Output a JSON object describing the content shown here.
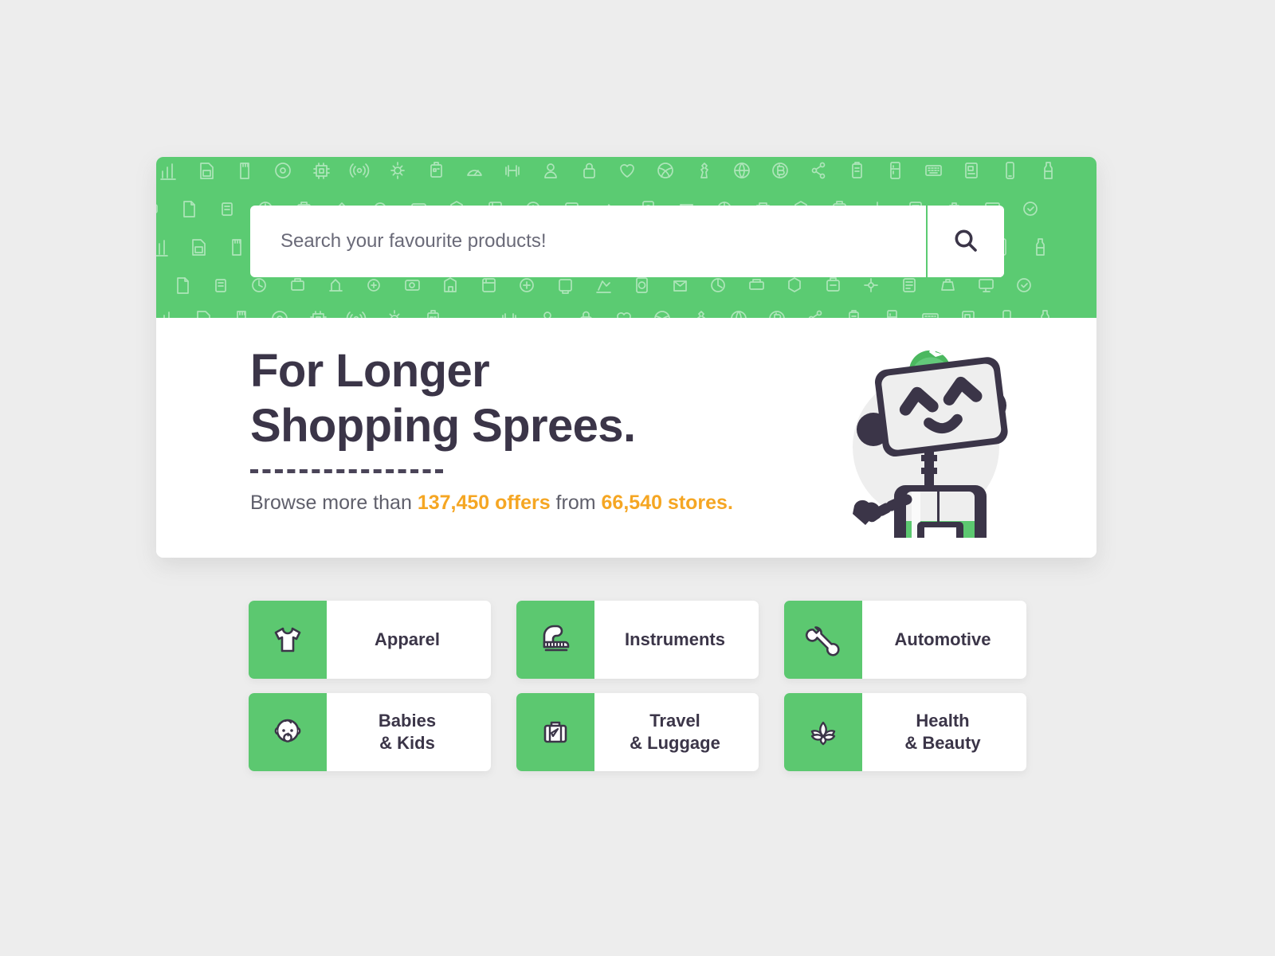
{
  "theme": {
    "page_background": "#ededed",
    "brand_green": "#5bcb72",
    "tile_green": "#5cc870",
    "ink": "#3b3548",
    "accent_orange": "#f5a623",
    "card_white": "#ffffff"
  },
  "search": {
    "placeholder": "Search your favourite products!",
    "value": "",
    "button_icon": "search-icon"
  },
  "hero": {
    "headline": "For Longer\nShopping Sprees.",
    "subtitle": {
      "prefix": "Browse more than ",
      "offers": "137,450 offers",
      "middle": " from ",
      "stores": "66,540 stores."
    },
    "mascot": "robot-mascot-illustration"
  },
  "categories": [
    {
      "label": "Apparel",
      "icon": "tshirt-icon"
    },
    {
      "label": "Instruments",
      "icon": "piano-icon"
    },
    {
      "label": "Automotive",
      "icon": "wrench-icon"
    },
    {
      "label": "Babies\n& Kids",
      "icon": "baby-face-icon"
    },
    {
      "label": "Travel\n& Luggage",
      "icon": "suitcase-icon"
    },
    {
      "label": "Health\n& Beauty",
      "icon": "lotus-icon"
    }
  ]
}
